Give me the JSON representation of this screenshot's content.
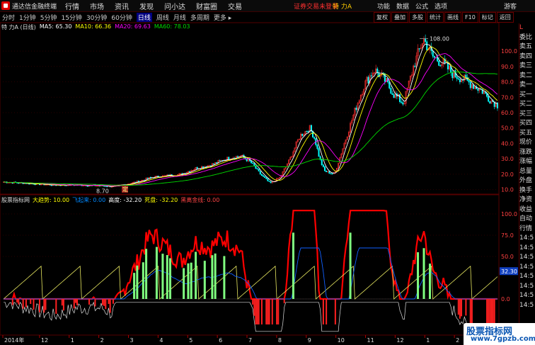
{
  "app": {
    "title": "通达信金融终端"
  },
  "menu": [
    "行情",
    "市场",
    "资讯",
    "发现",
    "问小达",
    "财富圈",
    "交易"
  ],
  "status": {
    "warning": "证券交易未登录",
    "stock": "特 力A"
  },
  "menu_right": [
    "功能",
    "数据",
    "公式",
    "选项"
  ],
  "user": "游客",
  "periods": [
    "分时",
    "1分钟",
    "5分钟",
    "15分钟",
    "30分钟",
    "60分钟",
    "日线",
    "周线",
    "月线",
    "多周期",
    "更多 ▸"
  ],
  "periods_active": 6,
  "toolbar": [
    "复权",
    "叠加",
    "多股",
    "统计",
    "画线",
    "F10",
    "标记",
    "返回"
  ],
  "ma": {
    "name": "特 力A (日线)",
    "ma5": "MA5: 65.30",
    "ma10": "MA10: 66.36",
    "ma20": "MA20: 69.63",
    "ma60": "MA60: 78.03"
  },
  "indicator": {
    "name": "股票指标网",
    "dqs": "大趋势: 10.00",
    "fly": "飞起来: 0.00",
    "gd": "高度: -32.20",
    "sp": "死盘: -32.20",
    "ic": "黑离金线: 0.00"
  },
  "labels": {
    "hi": "108.00",
    "lo": "8.70",
    "marker": "定",
    "cur": "32.30"
  },
  "rightpanel": [
    "委比",
    "卖五",
    "卖四",
    "卖三",
    "卖二",
    "卖一",
    "买一",
    "买二",
    "买三",
    "买四",
    "买五",
    "现价",
    "涨跌",
    "涨幅",
    "总量",
    "外盘",
    "换手",
    "净资",
    "收益",
    "自动",
    "行情",
    "14:5",
    "14:5",
    "14:5",
    "14:5",
    "14:5",
    "14:5",
    "14:5",
    "14:5"
  ],
  "rp_top": "L",
  "watermark": {
    "line1": "股票指标网",
    "line2": "www.7gpzb.com"
  },
  "colors": {
    "ma5": "#ffffff",
    "ma10": "#ffff00",
    "ma20": "#ff00ff",
    "ma60": "#00dd00",
    "up": "#ff3030",
    "down": "#00ffff",
    "indicator": "#ff0000"
  },
  "chart_data": [
    {
      "type": "candlestick",
      "title": "特 力A (日线)",
      "series": [
        {
          "name": "MA5",
          "last": 65.3
        },
        {
          "name": "MA10",
          "last": 66.36
        },
        {
          "name": "MA20",
          "last": 69.63
        },
        {
          "name": "MA60",
          "last": 78.03
        }
      ],
      "ylim": [
        8,
        112
      ],
      "yticks": [
        10,
        20,
        30,
        40,
        50,
        60,
        70,
        80,
        90,
        100
      ],
      "annotations": [
        {
          "label": "108.00",
          "value": 108
        },
        {
          "label": "8.70",
          "value": 8.7
        }
      ],
      "x_ticks": [
        "2014年",
        "12",
        "1",
        "2",
        "3",
        "4",
        "5",
        "6",
        "7",
        "8",
        "9",
        "10",
        "11",
        "12",
        "1",
        "2",
        "3"
      ],
      "price_path": [
        [
          0,
          15
        ],
        [
          5,
          14
        ],
        [
          10,
          13
        ],
        [
          15,
          13
        ],
        [
          20,
          12.5
        ],
        [
          22,
          12
        ],
        [
          24,
          13
        ],
        [
          27,
          15
        ],
        [
          30,
          18
        ],
        [
          33,
          19
        ],
        [
          36,
          20
        ],
        [
          39,
          24
        ],
        [
          42,
          26
        ],
        [
          45,
          30
        ],
        [
          48,
          32
        ],
        [
          50,
          28
        ],
        [
          52,
          20
        ],
        [
          54,
          14
        ],
        [
          56,
          18
        ],
        [
          58,
          30
        ],
        [
          60,
          45
        ],
        [
          62,
          50
        ],
        [
          63,
          43
        ],
        [
          64,
          30
        ],
        [
          65,
          22
        ],
        [
          67,
          20
        ],
        [
          69,
          40
        ],
        [
          71,
          60
        ],
        [
          73,
          78
        ],
        [
          75,
          88
        ],
        [
          77,
          82
        ],
        [
          79,
          72
        ],
        [
          81,
          66
        ],
        [
          83,
          90
        ],
        [
          85,
          108
        ],
        [
          87,
          96
        ],
        [
          89,
          92
        ],
        [
          91,
          85
        ],
        [
          93,
          82
        ],
        [
          95,
          78
        ],
        [
          97,
          74
        ],
        [
          98,
          70
        ],
        [
          100,
          65
        ]
      ]
    },
    {
      "type": "line",
      "title": "股票指标网",
      "series": [
        {
          "name": "大趋势",
          "last": 10.0
        },
        {
          "name": "飞起来",
          "last": 0.0
        },
        {
          "name": "高度",
          "last": -32.2
        },
        {
          "name": "死盘",
          "last": -32.2
        },
        {
          "name": "黑离金线",
          "last": 0.0
        }
      ],
      "ylim": [
        -40,
        110
      ],
      "yticks": [
        0,
        50,
        75,
        100
      ],
      "current": 32.3
    }
  ]
}
